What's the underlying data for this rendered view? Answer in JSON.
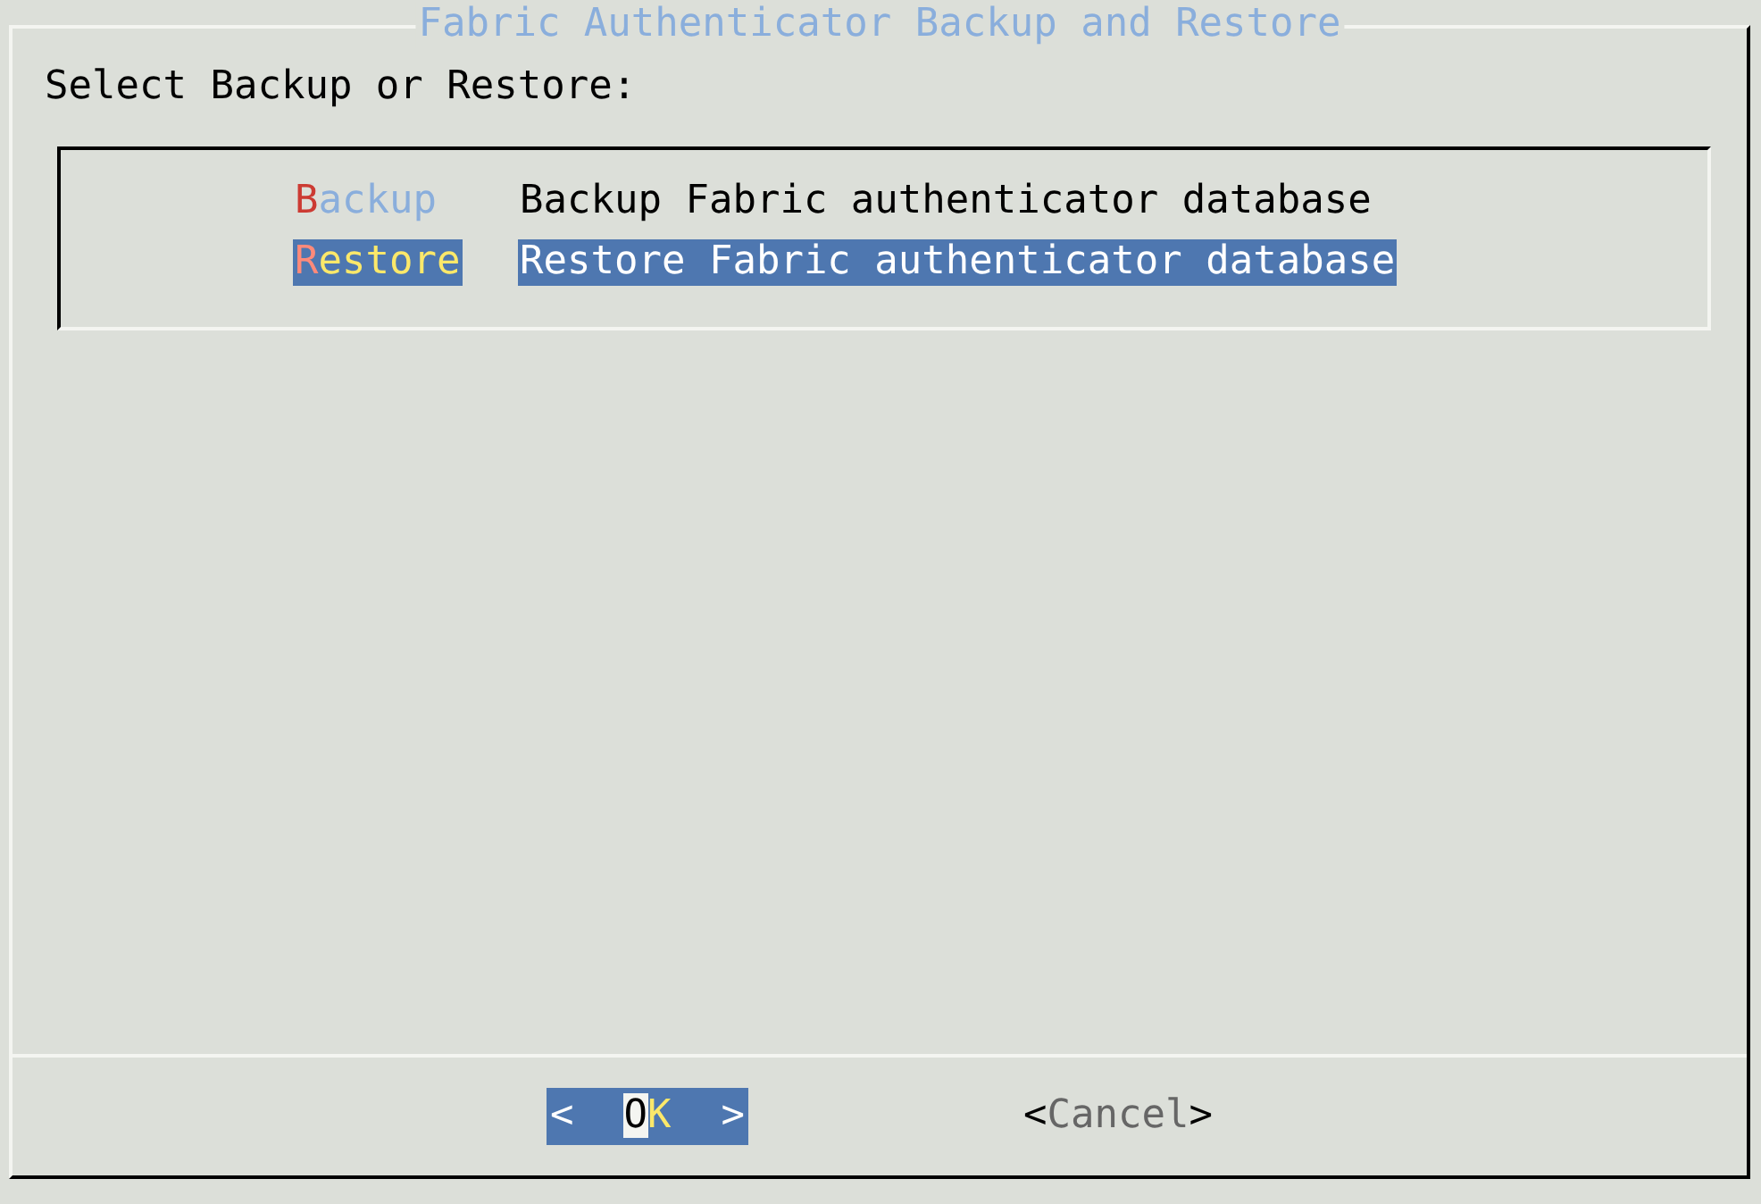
{
  "dialog": {
    "title": "Fabric Authenticator Backup and Restore",
    "prompt": "Select Backup or Restore:",
    "items": [
      {
        "tag": "Backup",
        "description": "Backup Fabric authenticator database",
        "selected": false
      },
      {
        "tag": "Restore",
        "description": "Restore Fabric authenticator database",
        "selected": true
      }
    ],
    "buttons": [
      {
        "open": "<",
        "label": "OK",
        "close": ">",
        "selected": true
      },
      {
        "open": "<",
        "label": "Cancel",
        "close": ">",
        "selected": false
      }
    ]
  }
}
